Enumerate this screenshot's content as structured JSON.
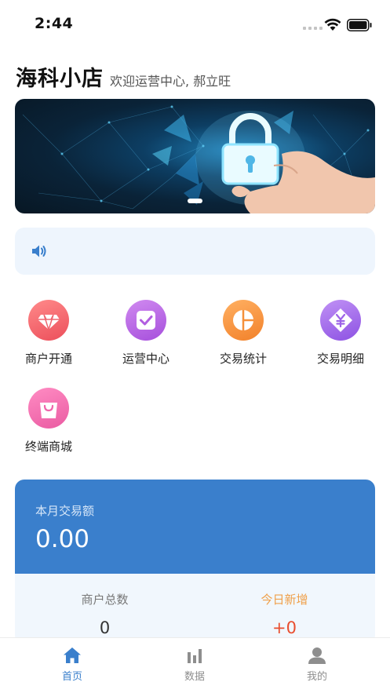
{
  "status_bar": {
    "time": "2:44",
    "icons": [
      "signal-icon",
      "wifi-icon",
      "battery-icon"
    ]
  },
  "header": {
    "title": "海科小店",
    "welcome": "欢迎运营中心, 郝立旺"
  },
  "banner": {
    "image": "lock-hand-banner",
    "active_slide": 1
  },
  "notice": {
    "icon": "speaker-icon",
    "text": ""
  },
  "grid": [
    {
      "label": "商户开通",
      "icon": "diamond-icon",
      "color": "#f2636a"
    },
    {
      "label": "运营中心",
      "icon": "checkbox-icon",
      "color": "#b25ee0"
    },
    {
      "label": "交易统计",
      "icon": "pie-chart-icon",
      "color": "#f5903a"
    },
    {
      "label": "交易明细",
      "icon": "yuan-icon",
      "color": "#9d63e8"
    },
    {
      "label": "终端商城",
      "icon": "shopping-bag-icon",
      "color": "#ef67ac"
    }
  ],
  "card": {
    "title": "本月交易额",
    "amount": "0.00",
    "stats": [
      {
        "label": "商户总数",
        "value": "0",
        "color": "#666666"
      },
      {
        "label": "今日新增",
        "value": "+0",
        "color": "#f0a04a"
      }
    ],
    "accent": "#3a7fcc",
    "new_value_color": "#e94e2f"
  },
  "tabs": [
    {
      "label": "首页",
      "icon": "home-icon",
      "active": true
    },
    {
      "label": "数据",
      "icon": "bar-chart-icon",
      "active": false
    },
    {
      "label": "我的",
      "icon": "user-icon",
      "active": false
    }
  ],
  "colors": {
    "active_tab": "#3a7fcc",
    "inactive_tab": "#8e8e8e"
  }
}
